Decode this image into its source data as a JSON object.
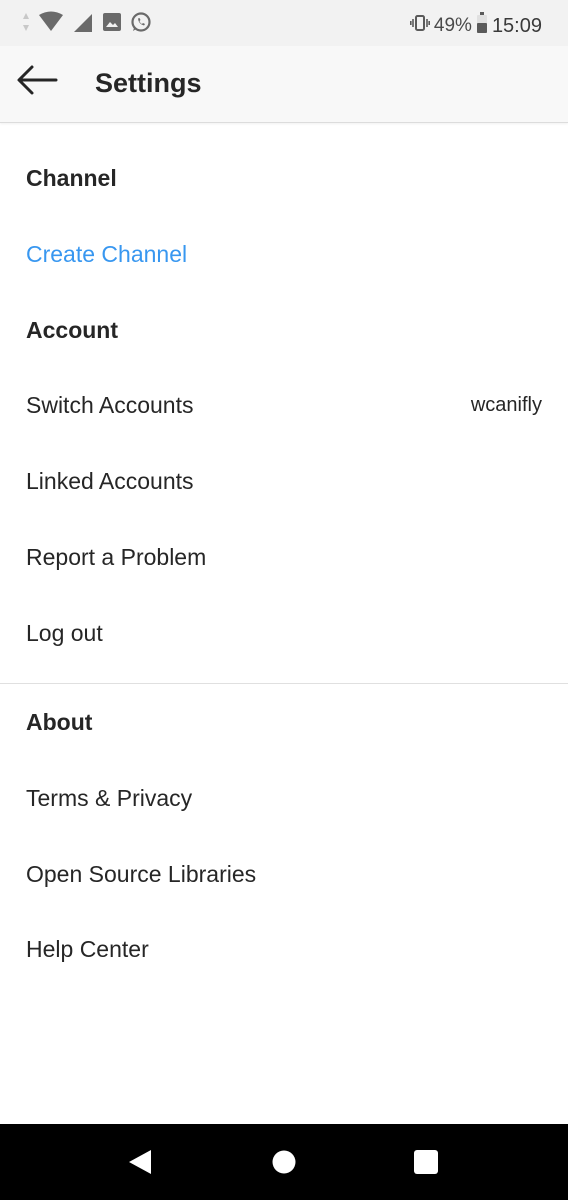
{
  "status_bar": {
    "battery_percent": "49%",
    "time": "15:09",
    "icons": [
      "data-arrows-icon",
      "wifi-icon",
      "signal-icon",
      "gallery-icon",
      "whatsapp-icon",
      "vibrate-icon",
      "battery-icon"
    ]
  },
  "header": {
    "title": "Settings",
    "back_icon": "back-arrow-icon"
  },
  "sections": {
    "channel": {
      "title": "Channel",
      "items": [
        {
          "label": "Create Channel",
          "color": "#3897f0"
        }
      ]
    },
    "account": {
      "title": "Account",
      "items": [
        {
          "label": "Switch Accounts",
          "value": "wcanifly"
        },
        {
          "label": "Linked Accounts"
        },
        {
          "label": "Report a Problem"
        },
        {
          "label": "Log out"
        }
      ]
    },
    "about": {
      "title": "About",
      "items": [
        {
          "label": "Terms & Privacy"
        },
        {
          "label": "Open Source Libraries"
        },
        {
          "label": "Help Center"
        }
      ]
    }
  },
  "nav_bar": {
    "icons": [
      "back-triangle-icon",
      "home-circle-icon",
      "recents-square-icon"
    ]
  },
  "colors": {
    "link_blue": "#3897f0",
    "text": "#262626",
    "status_bar_bg": "#f2f2f2",
    "nav_bar_bg": "#000000"
  }
}
